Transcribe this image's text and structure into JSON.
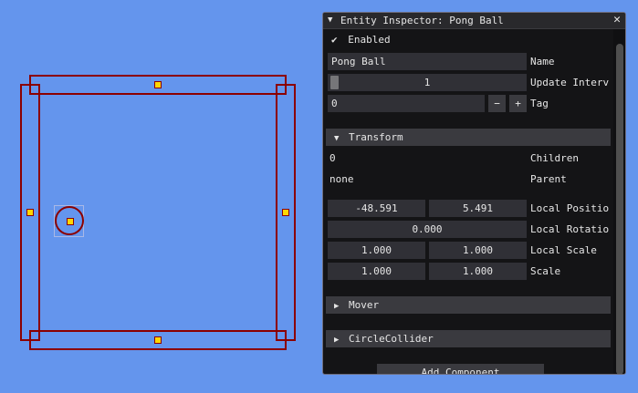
{
  "inspector": {
    "title": "Entity Inspector: Pong Ball",
    "collapse_glyph": "▼",
    "close_glyph": "✕",
    "enabled_check": "✔",
    "enabled_label": "Enabled",
    "name_value": "Pong Ball",
    "name_label": "Name",
    "update_interval_value": "1",
    "update_interval_label": "Update Interv",
    "tag_value": "0",
    "tag_minus": "−",
    "tag_plus": "+",
    "tag_label": "Tag",
    "transform": {
      "header": "Transform",
      "arrow": "▼",
      "children_value": "0",
      "children_label": "Children",
      "parent_value": "none",
      "parent_label": "Parent",
      "local_position_x": "-48.591",
      "local_position_y": "5.491",
      "local_position_label": "Local Positio",
      "local_rotation": "0.000",
      "local_rotation_label": "Local Rotatio",
      "local_scale_x": "1.000",
      "local_scale_y": "1.000",
      "local_scale_label": "Local Scale",
      "scale_x": "1.000",
      "scale_y": "1.000",
      "scale_label": "Scale"
    },
    "components": [
      {
        "label": "Mover",
        "arrow": "▶"
      },
      {
        "label": "CircleCollider",
        "arrow": "▶"
      }
    ],
    "add_component_label": "Add Component"
  },
  "colors": {
    "background": "#6495ed",
    "collider": "#8b0000",
    "handle": "#ffd700",
    "panel": "#141416",
    "header": "#3a3a3f",
    "field": "#303036"
  }
}
